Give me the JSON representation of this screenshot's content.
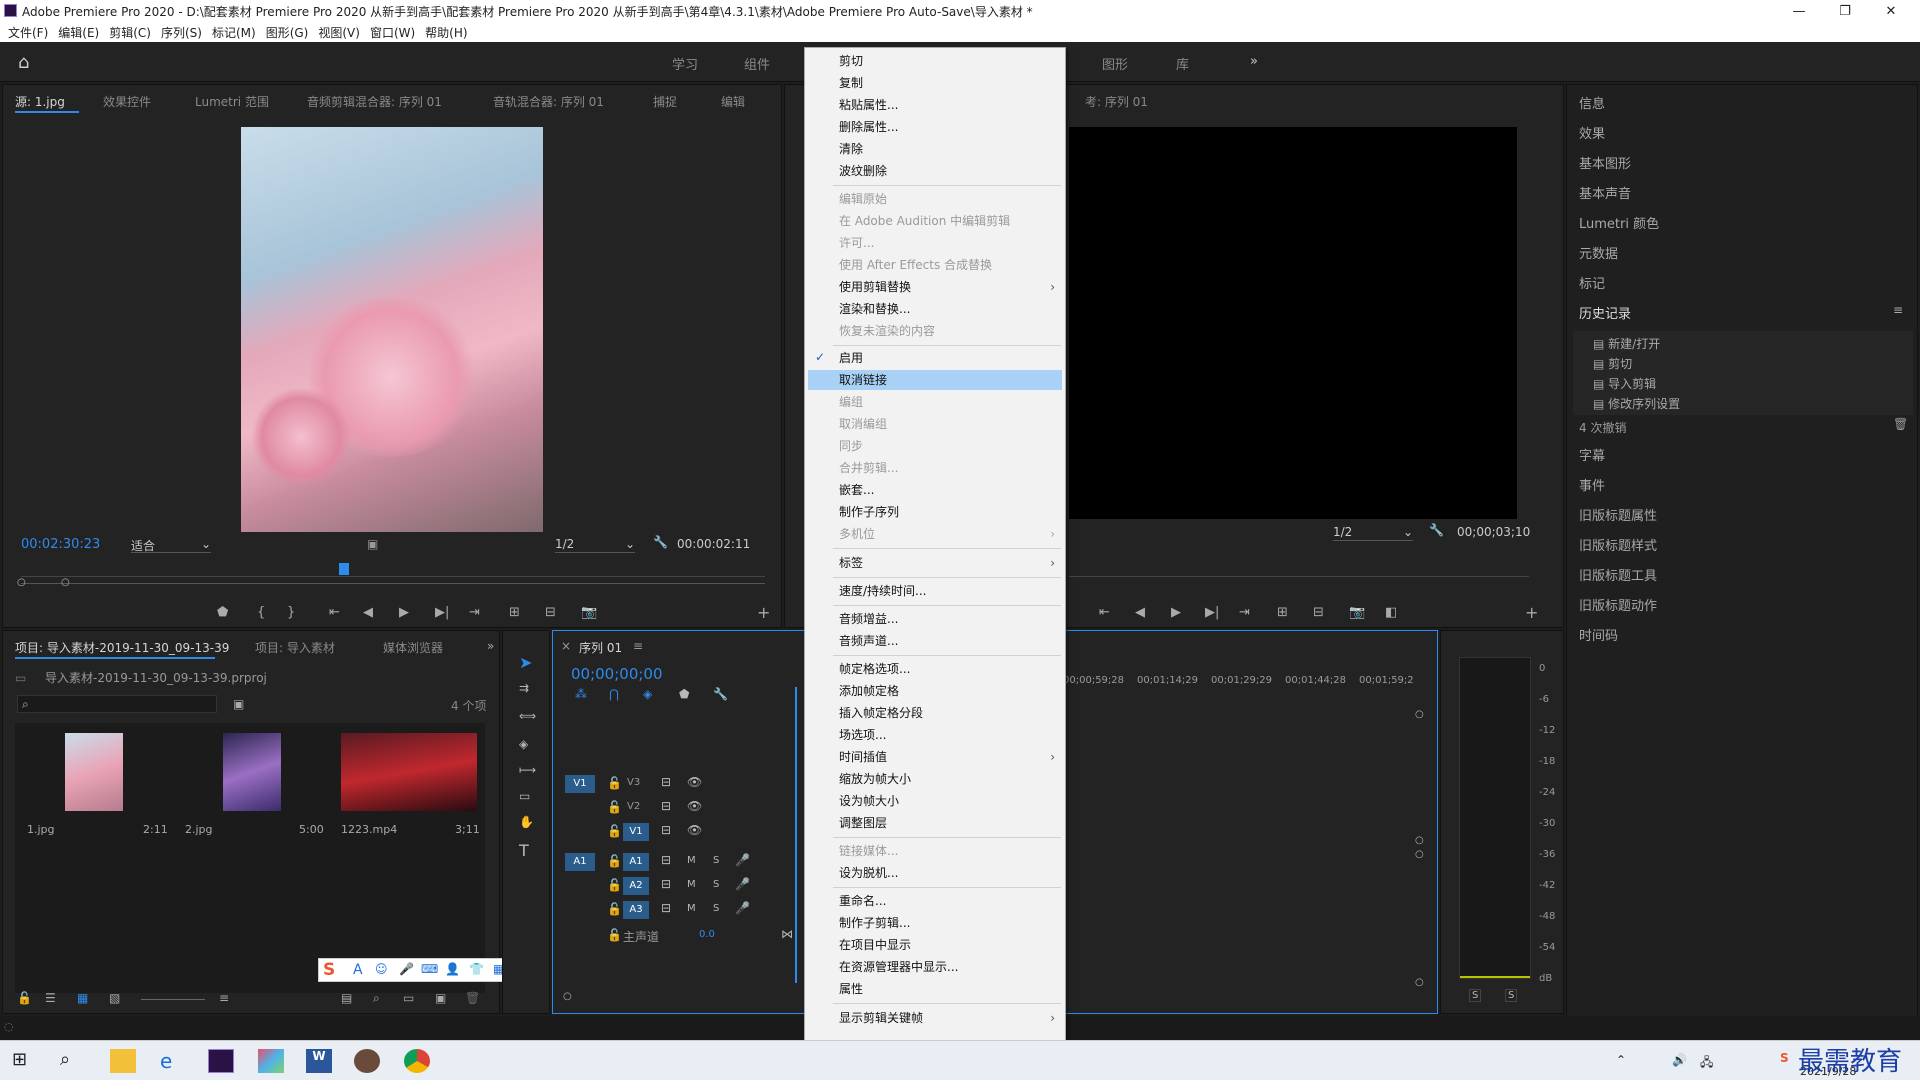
{
  "window": {
    "title": "Adobe Premiere Pro 2020 - D:\\配套素材 Premiere Pro 2020 从新手到高手\\配套素材 Premiere Pro 2020 从新手到高手\\第4章\\4.3.1\\素材\\Adobe Premiere Pro Auto-Save\\导入素材 *",
    "minimize": "—",
    "maximize": "❐",
    "close": "✕"
  },
  "menubar": [
    "文件(F)",
    "编辑(E)",
    "剪辑(C)",
    "序列(S)",
    "标记(M)",
    "图形(G)",
    "视图(V)",
    "窗口(W)",
    "帮助(H)"
  ],
  "workspace": {
    "tabs": [
      "学习",
      "组件",
      "图形",
      "库"
    ],
    "more": "»"
  },
  "source": {
    "tabs": [
      "源: 1.jpg",
      "效果控件",
      "Lumetri 范围",
      "音频剪辑混合器: 序列 01",
      "音轨混合器: 序列 01",
      "捕捉",
      "编辑"
    ],
    "timecode": "00:02:30:23",
    "fit": "适合",
    "resolution": "1/2",
    "duration": "00:00:02:11"
  },
  "program": {
    "title": "考: 序列 01",
    "resolution": "1/2",
    "timecode": "00;00;03;10"
  },
  "right_panel": {
    "items": [
      "信息",
      "效果",
      "基本图形",
      "基本声音",
      "Lumetri 颜色",
      "元数据",
      "标记"
    ],
    "history_title": "历史记录",
    "history": [
      "新建/打开",
      "剪切",
      "导入剪辑",
      "修改序列设置"
    ],
    "undo_count": "4 次撤销",
    "items2": [
      "字幕",
      "事件",
      "旧版标题属性",
      "旧版标题样式",
      "旧版标题工具",
      "旧版标题动作",
      "时间码"
    ]
  },
  "project": {
    "tabs": [
      "项目: 导入素材-2019-11-30_09-13-39",
      "项目: 导入素材",
      "媒体浏览器"
    ],
    "file": "导入素材-2019-11-30_09-13-39.prproj",
    "count": "4 个项",
    "items": [
      {
        "name": "1.jpg",
        "dur": "2:11"
      },
      {
        "name": "2.jpg",
        "dur": "5:00"
      },
      {
        "name": "1223.mp4",
        "dur": "3;11"
      }
    ]
  },
  "timeline": {
    "tab": "序列 01",
    "timecode": "00;00;00;00",
    "ruler": [
      "00;00;59;28",
      "00;01;14;29",
      "00;01;29;29",
      "00;01;44;28",
      "00;01;59;2"
    ],
    "tracks_v": [
      "V3",
      "V2",
      "V1"
    ],
    "tracks_a": [
      "A1",
      "A2",
      "A3"
    ],
    "master": "主声道",
    "master_val": "0.0",
    "src_v": "V1",
    "src_a": "A1",
    "m": "M",
    "s": "S"
  },
  "meter": {
    "scale": [
      "0",
      "-6",
      "-12",
      "-18",
      "-24",
      "-30",
      "-36",
      "-42",
      "-48",
      "-54",
      "dB"
    ],
    "solo": [
      "S",
      "S"
    ]
  },
  "context_menu": {
    "g1": [
      "剪切",
      "复制",
      "粘贴属性...",
      "删除属性...",
      "清除",
      "波纹删除"
    ],
    "g2": [
      "编辑原始",
      "在 Adobe Audition 中编辑剪辑",
      "许可...",
      "使用 After Effects 合成替换"
    ],
    "g2b": [
      "使用剪辑替换",
      "渲染和替换...",
      "恢复未渲染的内容"
    ],
    "g3": [
      "启用",
      "取消链接",
      "编组",
      "取消编组",
      "同步",
      "合并剪辑...",
      "嵌套...",
      "制作子序列",
      "多机位"
    ],
    "g4": [
      "标签"
    ],
    "g5": [
      "速度/持续时间..."
    ],
    "g6": [
      "音频增益...",
      "音频声道..."
    ],
    "g7": [
      "帧定格选项...",
      "添加帧定格",
      "插入帧定格分段",
      "场选项...",
      "时间插值",
      "缩放为帧大小",
      "设为帧大小",
      "调整图层"
    ],
    "g8": [
      "链接媒体...",
      "设为脱机..."
    ],
    "g9": [
      "重命名...",
      "制作子剪辑...",
      "在项目中显示",
      "在资源管理器中显示...",
      "属性"
    ],
    "g10": [
      "显示剪辑关键帧"
    ]
  },
  "taskbar": {
    "date": "2021/9/28",
    "watermark": "最需教育"
  },
  "colors": {
    "accent": "#2d8ceb",
    "highlight": "#a9d1f5",
    "menu_bg": "#f2f2f2"
  }
}
